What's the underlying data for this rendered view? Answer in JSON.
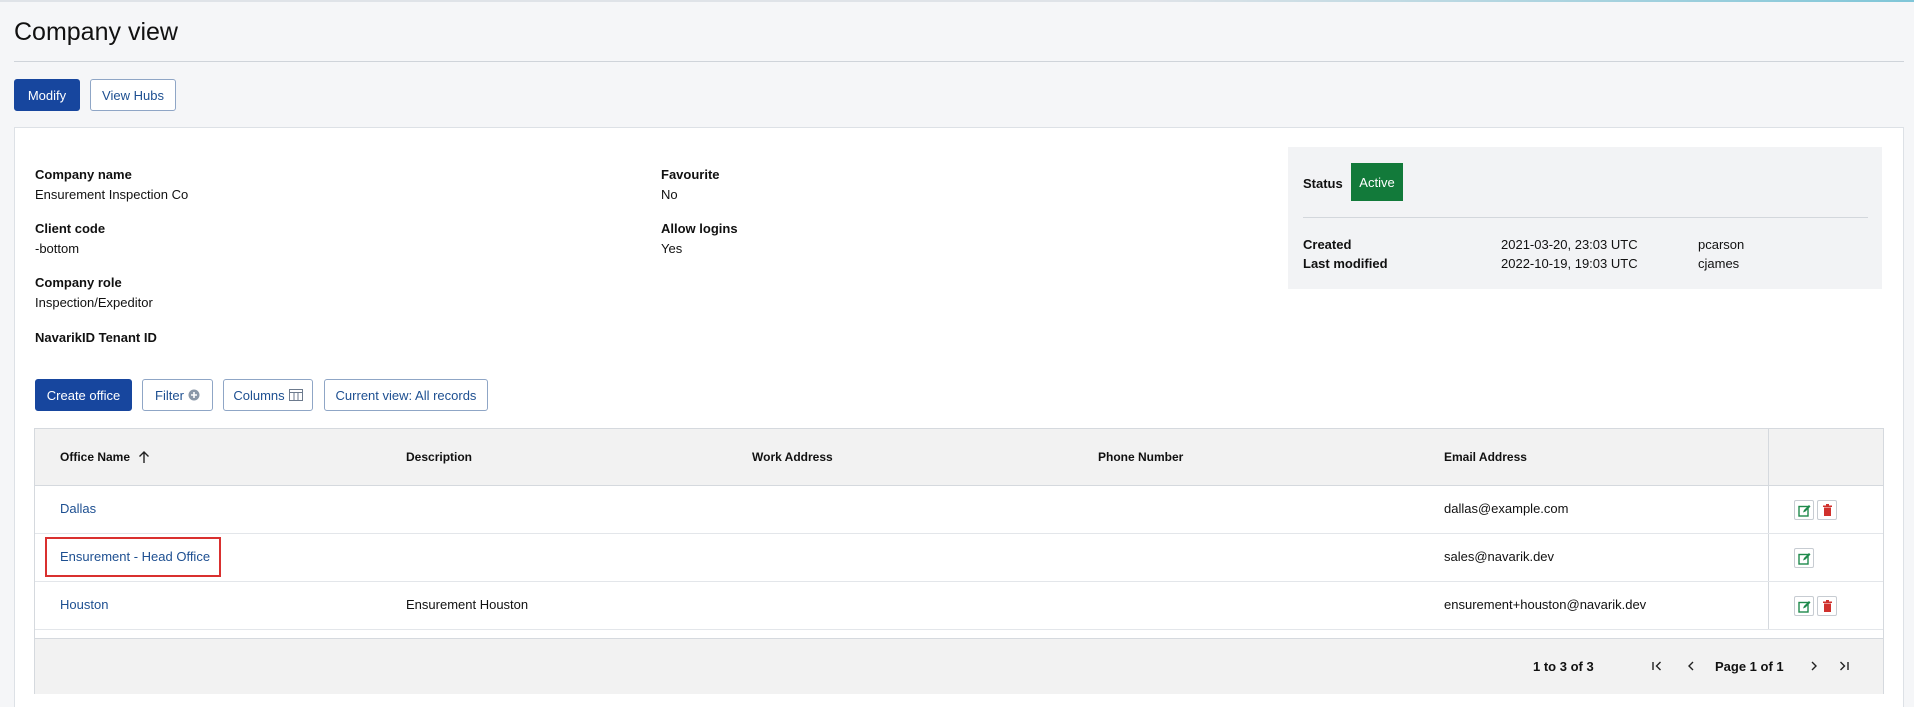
{
  "page": {
    "title": "Company view"
  },
  "actions": {
    "modify": "Modify",
    "view_hubs": "View Hubs"
  },
  "details": {
    "company_name": {
      "label": "Company name",
      "value": "Ensurement Inspection Co"
    },
    "client_code": {
      "label": "Client code",
      "value": "-bottom"
    },
    "company_role": {
      "label": "Company role",
      "value": "Inspection/Expeditor"
    },
    "tenant_id": {
      "label": "NavarikID Tenant ID",
      "value": ""
    },
    "favourite": {
      "label": "Favourite",
      "value": "No"
    },
    "allow_logins": {
      "label": "Allow logins",
      "value": "Yes"
    }
  },
  "status": {
    "label": "Status",
    "value": "Active",
    "created": {
      "label": "Created",
      "date": "2021-03-20, 23:03 UTC",
      "user": "pcarson"
    },
    "modified": {
      "label": "Last modified",
      "date": "2022-10-19, 19:03 UTC",
      "user": "cjames"
    }
  },
  "toolbar": {
    "create_office": "Create office",
    "filter": "Filter",
    "columns": "Columns",
    "current_view": "Current view: All records"
  },
  "table": {
    "columns": [
      "Office Name",
      "Description",
      "Work Address",
      "Phone Number",
      "Email Address"
    ],
    "rows": [
      {
        "name": "Dallas",
        "description": "",
        "work_address": "",
        "phone": "",
        "email": "dallas@example.com"
      },
      {
        "name": "Ensurement - Head Office",
        "description": "",
        "work_address": "",
        "phone": "",
        "email": "sales@navarik.dev"
      },
      {
        "name": "Houston",
        "description": "Ensurement Houston",
        "work_address": "",
        "phone": "",
        "email": "ensurement+houston@navarik.dev"
      }
    ]
  },
  "pagination": {
    "summary": "1 to 3 of 3",
    "page": "Page 1 of 1"
  },
  "colors": {
    "primary": "#17469e",
    "active": "#127a3a",
    "edit": "#1f8a4c",
    "delete": "#d0312d",
    "highlight": "#d9302f"
  }
}
